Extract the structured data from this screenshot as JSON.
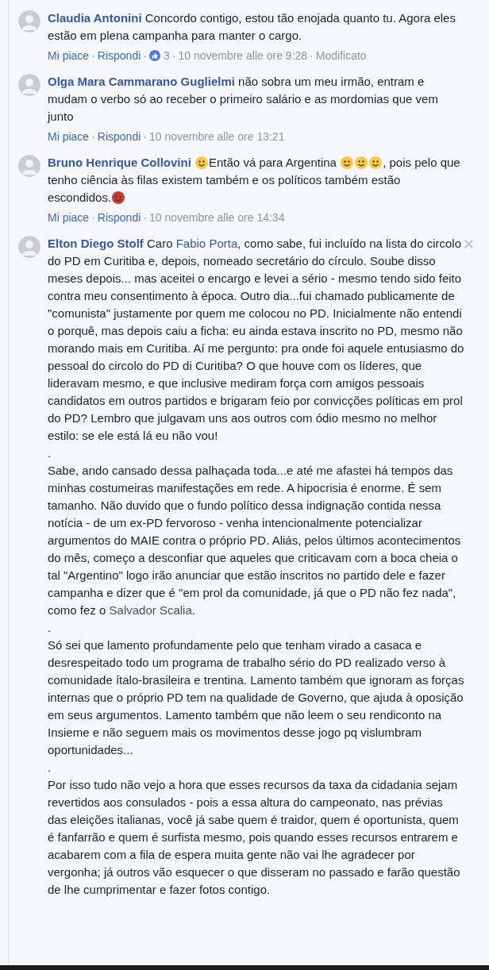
{
  "comments": [
    {
      "author": "Claudia Antonini",
      "hovered": false,
      "paragraphs": [
        [
          {
            "kind": "text",
            "text": "Concordo contigo, estou tão enojada quanto tu. Agora eles estão em plena campanha para manter o cargo."
          }
        ]
      ],
      "actions": {
        "separator": "·",
        "like": "Mi piace",
        "reply": "Rispondi",
        "reactions": "3",
        "time": "10 novembre alle ore 9:28",
        "edited": "Modificato"
      }
    },
    {
      "author": "Olga Mara Cammarano Guglielmi",
      "hovered": false,
      "paragraphs": [
        [
          {
            "kind": "text",
            "text": "não sobra um meu irmão, entram e mudam o verbo só ao receber o primeiro salário e as mordomias que vem junto"
          }
        ]
      ],
      "actions": {
        "separator": "·",
        "like": "Mi piace",
        "reply": "Rispondi",
        "time": "10 novembre alle ore 13:21"
      }
    },
    {
      "author": "Bruno Henrique Collovini",
      "hovered": false,
      "paragraphs": [
        [
          {
            "kind": "emoji",
            "color": "#f7c84a"
          },
          {
            "kind": "text",
            "text": "Então vá para Argentina "
          },
          {
            "kind": "emoji",
            "color": "#f7c84a"
          },
          {
            "kind": "emoji",
            "color": "#f7c84a"
          },
          {
            "kind": "emoji",
            "color": "#f7c84a"
          },
          {
            "kind": "text",
            "text": ", pois pelo que tenho ciência às filas existem também e os políticos também estão escondidos."
          },
          {
            "kind": "emoji",
            "color": "#c43b3b"
          }
        ]
      ],
      "actions": {
        "separator": "·",
        "like": "Mi piace",
        "reply": "Rispondi",
        "time": "10 novembre alle ore 14:34"
      }
    },
    {
      "author": "Elton Diego Stolf",
      "hovered": true,
      "paragraphs": [
        [
          {
            "kind": "text",
            "text": "Caro "
          },
          {
            "kind": "link",
            "text": "Fabio Porta"
          },
          {
            "kind": "text",
            "text": ", como sabe, fui incluído na lista do circolo do PD em Curitiba e, depois, nomeado secretário do círculo. Soube disso meses depois... mas aceitei o encargo e levei a sério - mesmo tendo sido feito contra meu consentimento à época. Outro dia...fui chamado publicamente de \"comunista\" justamente por quem me colocou no PD. Inicialmente não entendi o porquê, mas depois caiu a ficha: eu ainda estava inscrito no PD, mesmo não morando mais em Curitiba. Aí me pergunto: pra onde foi aquele entusiasmo do pessoal do circolo do PD di Curitiba? O que houve com os líderes, que lideravam mesmo, e que inclusive mediram força com amigos pessoais candidatos em outros partidos e brigaram feio por convicções políticas em prol do PD? Lembro que julgavam uns aos outros com ódio mesmo no melhor estilo: se ele está lá eu não vou!"
          }
        ],
        [
          {
            "kind": "text",
            "text": "."
          }
        ],
        [
          {
            "kind": "text",
            "text": "Sabe, ando cansado dessa palhaçada toda...e até me afastei há tempos das minhas costumeiras manifestações em rede. A hipocrisia é enorme. É sem tamanho. Não duvido que o fundo político dessa indignação contida nessa notícia - de um ex-PD fervoroso - venha intencionalmente potencializar argumentos do MAIE contra o próprio PD. Aliás, pelos últimos acontecimentos do mês, começo a desconfiar que aqueles que criticavam com a boca cheia o tal \"Argentino\" logo irão anunciar que estão inscritos no partido dele e fazer campanha e dizer que é \"em prol da comunidade, já que o PD não fez nada\", como fez o "
          },
          {
            "kind": "mention",
            "text": "Salvador Scalia"
          },
          {
            "kind": "text",
            "text": "."
          }
        ],
        [
          {
            "kind": "text",
            "text": "."
          }
        ],
        [
          {
            "kind": "text",
            "text": "Só sei que lamento profundamente pelo que tenham virado a casaca e desrespeitado todo um programa de trabalho sério do PD realizado verso à comunidade ítalo-brasileira e trentina. Lamento também que ignoram as forças internas que o próprio PD tem na qualidade de Governo, que ajuda à oposição em seus argumentos. Lamento também que não leem o seu rendiconto na Insieme e não seguem mais os movimentos desse jogo pq vislumbram oportunidades..."
          }
        ],
        [
          {
            "kind": "text",
            "text": "."
          }
        ],
        [
          {
            "kind": "text",
            "text": "Por isso tudo não vejo a hora que esses recursos da taxa da cidadania sejam revertidos aos consulados - pois a essa altura do campeonato, nas prévias das eleições italianas, você já sabe quem é traidor, quem é oportunista, quem é fanfarrão e quem é surfista mesmo, pois quando esses recursos entrarem e acabarem com a fila de espera muita gente não vai lhe agradecer por vergonha; já outros vão esquecer o que disseram no passado e farão questão de lhe cumprimentar e fazer fotos contigo."
          }
        ]
      ]
    }
  ]
}
